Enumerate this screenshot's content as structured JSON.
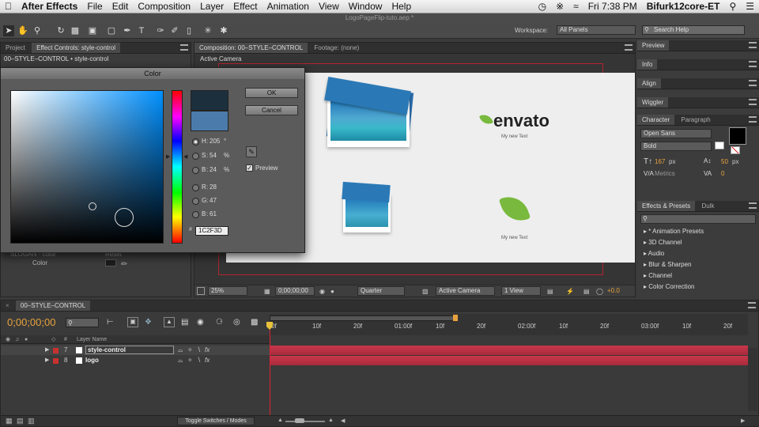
{
  "menubar": {
    "app": "After Effects",
    "items": [
      "File",
      "Edit",
      "Composition",
      "Layer",
      "Effect",
      "Animation",
      "View",
      "Window",
      "Help"
    ],
    "clock": "Fri 7:38 PM",
    "user": "Bifurk12core-ET"
  },
  "window_title": "LogoPageFlip-tuto.aep *",
  "workspace": {
    "label": "Workspace:",
    "value": "All Panels",
    "search_placeholder": "Search Help"
  },
  "left_panel": {
    "tabs": [
      "Project",
      "Effect Controls: style-control"
    ],
    "breadcrumb": "00–STYLE–CONTROL • style-control",
    "behind_rows": [
      {
        "name": "SLOGAN - color",
        "value": "Reset"
      },
      {
        "name": "Color",
        "value": ""
      }
    ]
  },
  "comp_panel": {
    "tab": "Composition: 00–STYLE–CONTROL",
    "footage_tab": "Footage: (none)",
    "camera_label": "Active Camera",
    "logo_text": "envato",
    "logo_sub_top": "My new Text",
    "logo_sub_bottom": "My new Text",
    "footer": {
      "zoom": "25%",
      "timecode": "0;00;00;00",
      "resolution": "Quarter",
      "camera": "Active Camera",
      "views": "1 View",
      "exposure": "+0.0"
    }
  },
  "color_dialog": {
    "title": "Color",
    "ok": "OK",
    "cancel": "Cancel",
    "preview_label": "Preview",
    "preview_checked": true,
    "new_color": "#1c2f3d",
    "old_color": "#4b7bab",
    "fields": [
      {
        "key": "H",
        "value": "205",
        "unit": "°",
        "selected": true
      },
      {
        "key": "S",
        "value": "54",
        "unit": "%",
        "selected": false
      },
      {
        "key": "B",
        "value": "24",
        "unit": "%",
        "selected": false
      },
      {
        "key": "R",
        "value": "28",
        "unit": "",
        "selected": false
      },
      {
        "key": "G",
        "value": "47",
        "unit": "",
        "selected": false
      },
      {
        "key": "B",
        "value": "61",
        "unit": "",
        "selected": false
      }
    ],
    "hex": "1C2F3D"
  },
  "right_panels": {
    "preview": "Preview",
    "info": "Info",
    "align": "Align",
    "wiggler": "Wiggler",
    "character_tabs": [
      "Character",
      "Paragraph"
    ],
    "font": "Open Sans",
    "style": "Bold",
    "size": "167",
    "size_unit": "px",
    "leading": "50",
    "leading_unit": "px",
    "kerning": "Metrics",
    "tracking": "0",
    "effects_tabs": [
      "Effects & Presets",
      "Dulk"
    ],
    "effects_list": [
      "* Animation Presets",
      "3D Channel",
      "Audio",
      "Blur & Sharpen",
      "Channel",
      "Color Correction"
    ]
  },
  "timeline": {
    "tab": "00–STYLE–CONTROL",
    "timecode": "0;00;00;00",
    "col_header": "Layer Name",
    "layers": [
      {
        "num": "7",
        "name": "style-control",
        "color": "#c8312f"
      },
      {
        "num": "8",
        "name": "logo",
        "color": "#c8312f"
      }
    ],
    "ruler": [
      "0f",
      "10f",
      "20f",
      "01:00f",
      "10f",
      "20f",
      "02:00f",
      "10f",
      "20f",
      "03:00f",
      "10f",
      "20f"
    ],
    "toggle_label": "Toggle Switches / Modes"
  }
}
